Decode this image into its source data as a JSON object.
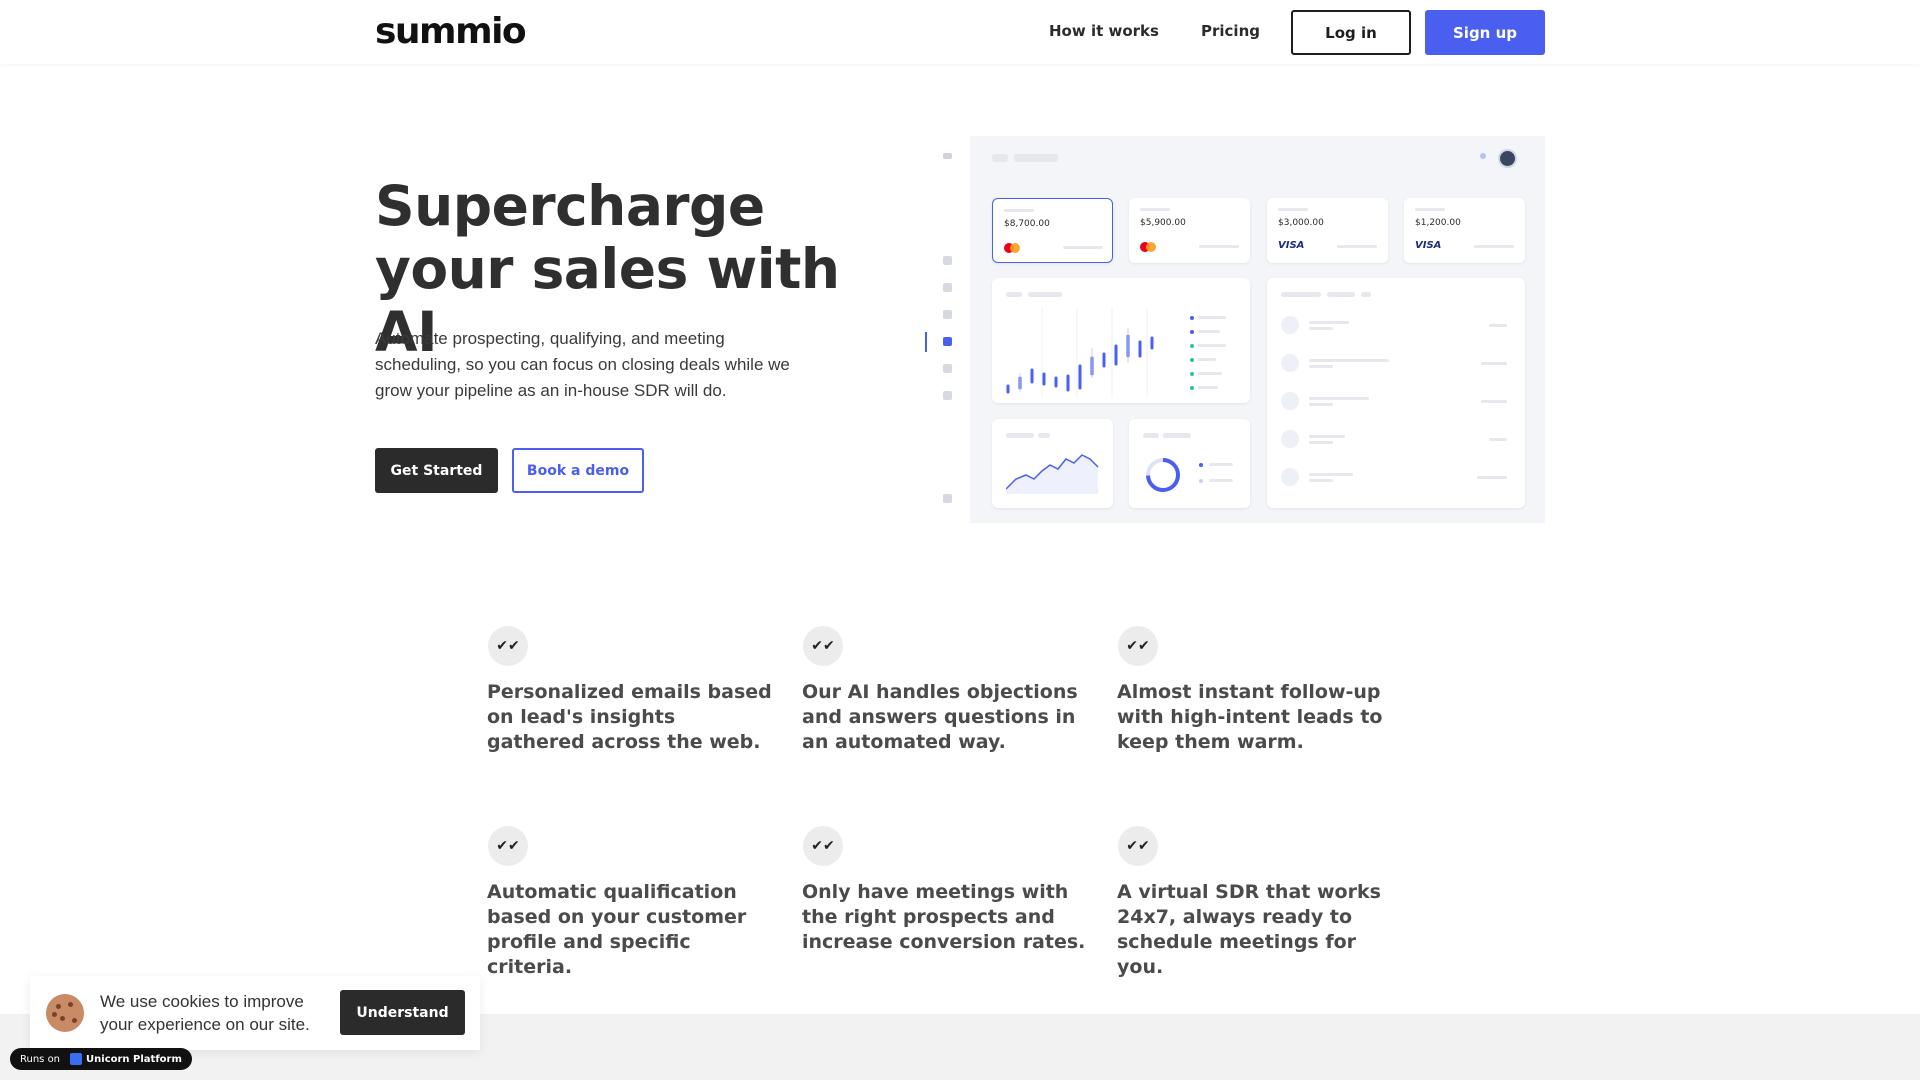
{
  "header": {
    "logo": "summio",
    "nav": [
      "How it works",
      "Pricing"
    ],
    "login_label": "Log in",
    "signup_label": "Sign up"
  },
  "hero": {
    "title": "Supercharge your sales with AI",
    "subtitle": "Automate prospecting, qualifying, and meeting scheduling, so you can focus on closing deals while we grow your pipeline as an in-house SDR will do.",
    "primary_cta": "Get Started",
    "secondary_cta": "Book a demo"
  },
  "dashboard": {
    "cards": [
      {
        "amount": "$8,700.00",
        "brand": "mastercard-icon"
      },
      {
        "amount": "$5,900.00",
        "brand": "mastercard-icon"
      },
      {
        "amount": "$3,000.00",
        "brand": "VISA"
      },
      {
        "amount": "$1,200.00",
        "brand": "VISA"
      }
    ]
  },
  "features": [
    {
      "icon": "double-check-icon",
      "text": "Personalized emails based on lead's insights gathered across the web."
    },
    {
      "icon": "double-check-icon",
      "text": "Our AI handles objections and answers questions in an automated way."
    },
    {
      "icon": "double-check-icon",
      "text": "Almost instant follow-up with high-intent leads to keep them warm."
    },
    {
      "icon": "double-check-icon",
      "text": "Automatic qualification based on your customer profile and specific criteria."
    },
    {
      "icon": "double-check-icon",
      "text": "Only have meetings with the right prospects and increase conversion rates."
    },
    {
      "icon": "double-check-icon",
      "text": "A virtual SDR that works 24x7, always ready to schedule meetings for you."
    }
  ],
  "cookie": {
    "message": "We use cookies to improve your experience on our site.",
    "button": "Understand"
  },
  "badge": {
    "runs_on": "Runs on",
    "platform": "Unicorn Platform"
  },
  "colors": {
    "accent": "#4a5ff0",
    "dark": "#2b2b2b"
  }
}
